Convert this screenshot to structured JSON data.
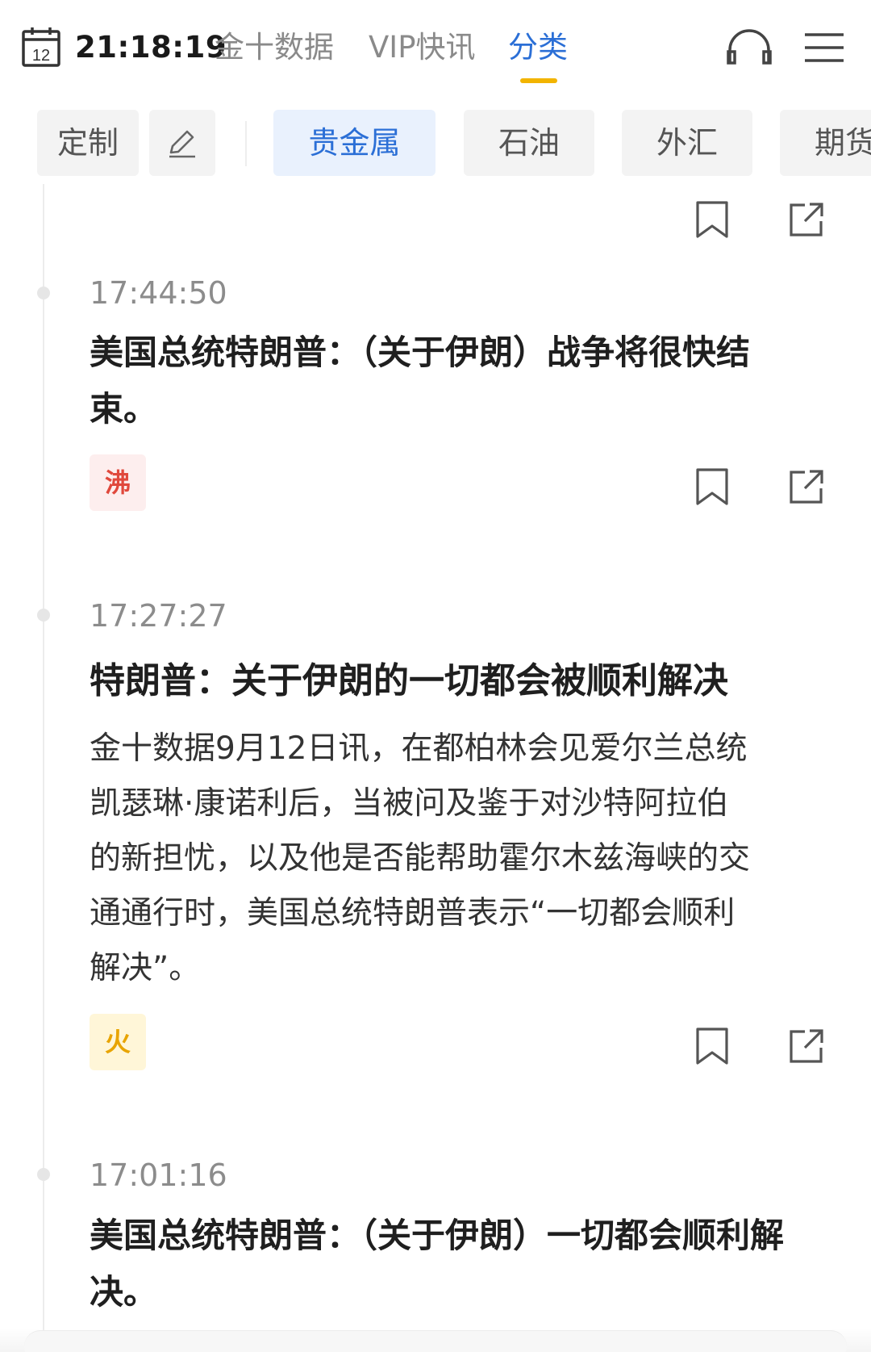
{
  "header": {
    "calendar_day": "12",
    "clock": "21:18:19",
    "tabs": [
      {
        "label": "金十数据"
      },
      {
        "label": "VIP快讯"
      },
      {
        "label": "分类"
      }
    ],
    "active_tab": "分类",
    "icons": {
      "left": "calendar-icon",
      "right_1": "headphones-icon",
      "right_2": "menu-icon"
    }
  },
  "category_bar": {
    "custom_label": "定制",
    "edit_icon": "pencil-icon",
    "items": [
      {
        "label": "贵金属"
      },
      {
        "label": "石油"
      },
      {
        "label": "外汇"
      },
      {
        "label": "期货"
      }
    ],
    "active": "贵金属"
  },
  "feed": [
    {
      "time": "17:44:50",
      "headline_line1": "美国总统特朗普：（关于伊朗）战争将很快结",
      "headline_line2": "束。",
      "badge": "沸"
    },
    {
      "time": "17:27:27",
      "headline_line1": "特朗普：关于伊朗的一切都会被顺利解决",
      "body_lines": [
        "金十数据9月12日讯，在都柏林会见爱尔兰总统",
        "凯瑟琳·康诺利后，当被问及鉴于对沙特阿拉伯",
        "的新担忧，以及他是否能帮助霍尔木兹海峡的交",
        "通通行时，美国总统特朗普表示“一切都会顺利",
        "解决”。"
      ],
      "badge": "火"
    },
    {
      "time": "17:01:16",
      "headline_line1": "美国总统特朗普：（关于伊朗）一切都会顺利解",
      "headline_line2": "决。"
    }
  ],
  "colors": {
    "accent_blue": "#2b6fd6",
    "tab_underline": "#f2b400",
    "badge_hot": "#e0483c",
    "badge_fire": "#e8a400"
  }
}
